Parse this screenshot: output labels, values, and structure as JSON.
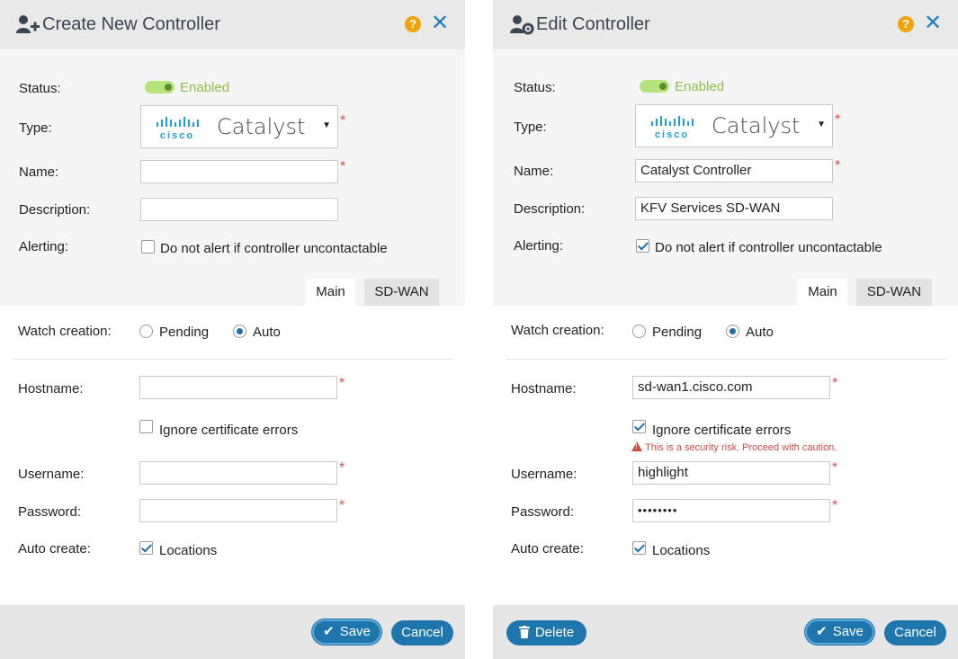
{
  "create": {
    "title": "Create New Controller",
    "status_label": "Status:",
    "status_value": "Enabled",
    "type_label": "Type:",
    "type_value": "Catalyst",
    "name_label": "Name:",
    "name_value": "",
    "description_label": "Description:",
    "description_value": "",
    "alerting_label": "Alerting:",
    "alerting_option": "Do not alert if controller uncontactable",
    "tabs": [
      "Main",
      "SD-WAN"
    ],
    "watch_label": "Watch creation:",
    "watch_pending": "Pending",
    "watch_auto": "Auto",
    "hostname_label": "Hostname:",
    "hostname_value": "",
    "ignore_cert_label": "Ignore certificate errors",
    "username_label": "Username:",
    "username_value": "",
    "password_label": "Password:",
    "password_value": "",
    "autocreate_label": "Auto create:",
    "locations_label": "Locations",
    "save_label": "Save",
    "cancel_label": "Cancel"
  },
  "edit": {
    "title": "Edit Controller",
    "status_label": "Status:",
    "status_value": "Enabled",
    "type_label": "Type:",
    "type_value": "Catalyst",
    "name_label": "Name:",
    "name_value": "Catalyst Controller",
    "description_label": "Description:",
    "description_value": "KFV Services SD-WAN",
    "alerting_label": "Alerting:",
    "alerting_option": "Do not alert if controller uncontactable",
    "tabs": [
      "Main",
      "SD-WAN"
    ],
    "watch_label": "Watch creation:",
    "watch_pending": "Pending",
    "watch_auto": "Auto",
    "hostname_label": "Hostname:",
    "hostname_value": "sd-wan1.cisco.com",
    "ignore_cert_label": "Ignore certificate errors",
    "cert_warning": "This is a security risk. Proceed with caution.",
    "username_label": "Username:",
    "username_value": "highlight",
    "password_label": "Password:",
    "password_value": "••••••••",
    "autocreate_label": "Auto create:",
    "locations_label": "Locations",
    "delete_label": "Delete",
    "save_label": "Save",
    "cancel_label": "Cancel"
  },
  "icons": {
    "help": "?",
    "close": "✕",
    "select_arrow": "▼",
    "save": "✔",
    "delete": "🗑",
    "cisco_logo": "cisco"
  },
  "colors": {
    "accent": "#1f76ad",
    "help": "#f0a30a",
    "toggle_on": "#b6e37a",
    "required": "#d9534f"
  }
}
